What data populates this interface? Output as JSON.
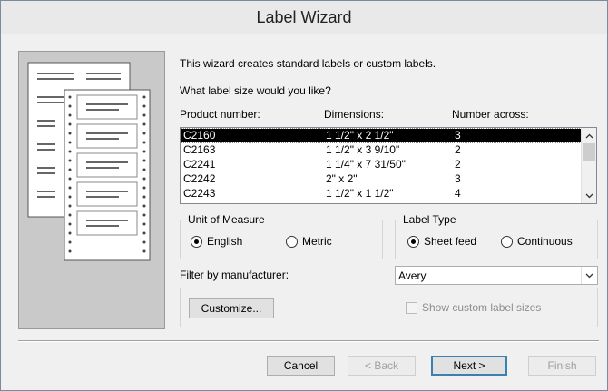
{
  "window": {
    "title": "Label Wizard"
  },
  "intro": "This wizard creates standard labels or custom labels.",
  "question": "What label size would you like?",
  "columns": {
    "product": "Product number:",
    "dimensions": "Dimensions:",
    "across": "Number across:"
  },
  "rows": [
    {
      "product": "C2160",
      "dimensions": "1 1/2\" x 2 1/2\"",
      "across": "3",
      "selected": true
    },
    {
      "product": "C2163",
      "dimensions": "1 1/2\" x 3 9/10\"",
      "across": "2"
    },
    {
      "product": "C2241",
      "dimensions": "1 1/4\" x 7 31/50\"",
      "across": "2"
    },
    {
      "product": "C2242",
      "dimensions": "2\" x 2\"",
      "across": "3"
    },
    {
      "product": "C2243",
      "dimensions": "1 1/2\" x 1 1/2\"",
      "across": "4"
    }
  ],
  "unit_of_measure": {
    "label": "Unit of Measure",
    "english": "English",
    "metric": "Metric",
    "selected": "English"
  },
  "label_type": {
    "label": "Label Type",
    "sheet_feed": "Sheet feed",
    "continuous": "Continuous",
    "selected": "Sheet feed"
  },
  "filter": {
    "label": "Filter by manufacturer:",
    "value": "Avery"
  },
  "customize_label": "Customize...",
  "show_custom": {
    "label": "Show custom label sizes",
    "checked": false,
    "enabled": false
  },
  "buttons": {
    "cancel": "Cancel",
    "back": "< Back",
    "next": "Next >",
    "finish": "Finish"
  },
  "icons": {
    "scroll_up": "chevron-up-icon",
    "scroll_down": "chevron-down-icon",
    "dropdown": "chevron-down-icon"
  }
}
